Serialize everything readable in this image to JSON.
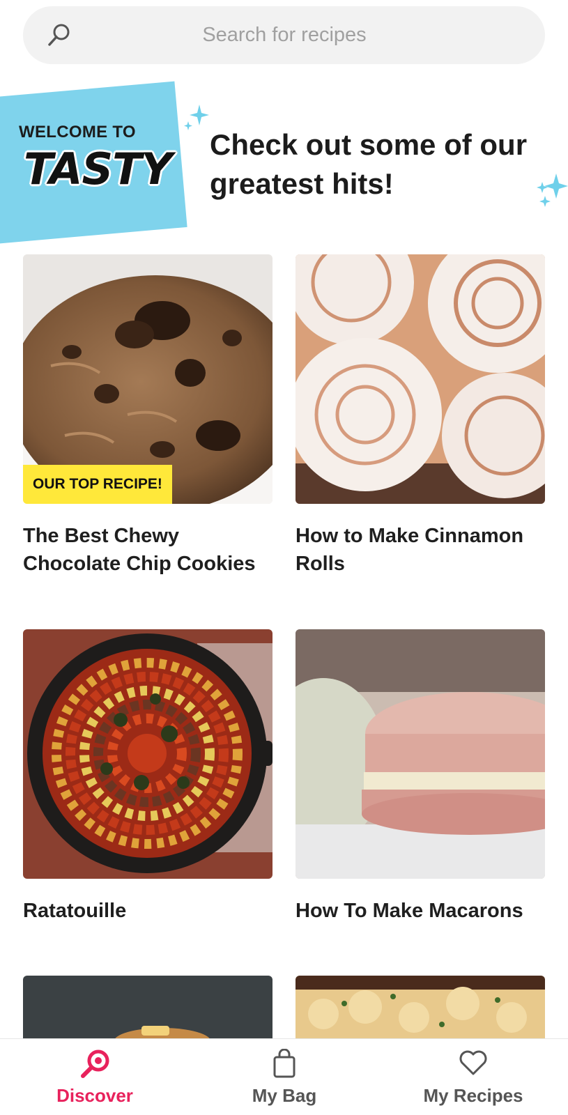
{
  "search": {
    "placeholder": "Search for recipes"
  },
  "banner": {
    "welcome": "WELCOME TO",
    "logo_text": "TASTY",
    "headline": "Check out some of our greatest hits!"
  },
  "recipes": [
    {
      "title": "The Best Chewy Chocolate Chip Cookies",
      "badge": "OUR TOP RECIPE!"
    },
    {
      "title": "How to Make Cinnamon Rolls"
    },
    {
      "title": "Ratatouille"
    },
    {
      "title": "How To Make Macarons"
    }
  ],
  "nav": [
    {
      "label": "Discover",
      "icon": "search-icon",
      "active": true
    },
    {
      "label": "My Bag",
      "icon": "bag-icon",
      "active": false
    },
    {
      "label": "My Recipes",
      "icon": "heart-icon",
      "active": false
    }
  ],
  "colors": {
    "accent": "#e8225c",
    "banner": "#7fd3ec",
    "badge": "#ffe83a"
  }
}
